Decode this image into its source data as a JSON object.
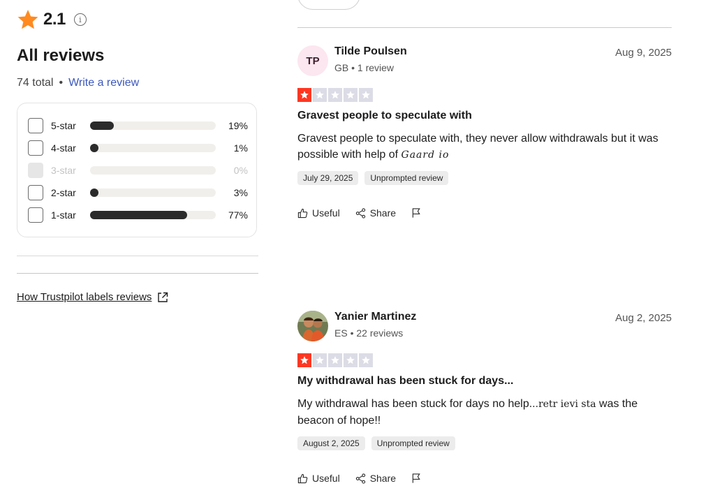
{
  "summary": {
    "rating": "2.1",
    "info_glyph": "i",
    "heading": "All reviews",
    "total": "74 total",
    "separator": "•",
    "write_review": "Write a review",
    "distribution": [
      {
        "label": "5-star",
        "pct": "19%",
        "fraction": 0.19,
        "disabled": false
      },
      {
        "label": "4-star",
        "pct": "1%",
        "fraction": 0.01,
        "disabled": false
      },
      {
        "label": "3-star",
        "pct": "0%",
        "fraction": 0.0,
        "disabled": true
      },
      {
        "label": "2-star",
        "pct": "3%",
        "fraction": 0.03,
        "disabled": false
      },
      {
        "label": "1-star",
        "pct": "77%",
        "fraction": 0.77,
        "disabled": false
      }
    ],
    "labels_link": "How Trustpilot labels reviews"
  },
  "reviews": [
    {
      "avatar_initials": "TP",
      "author": "Tilde Poulsen",
      "meta": "GB • 1 review",
      "date": "Aug 9, 2025",
      "stars": 1,
      "title": "Gravest people to speculate with",
      "body": "Gravest people to speculate with, they never allow withdrawals but it was possible with help of ",
      "body_script": "Gaard io",
      "tag_date": "July 29, 2025",
      "tag_kind": "Unprompted review",
      "useful": "Useful",
      "share": "Share"
    },
    {
      "avatar_initials": "",
      "author": "Yanier Martinez",
      "meta": "ES • 22 reviews",
      "date": "Aug 2, 2025",
      "stars": 1,
      "title": "My withdrawal has been stuck for days...",
      "body": "My withdrawal has been stuck for days no help...",
      "body_script": "retr ievi sta",
      "body_tail": " was the beacon of hope!!",
      "tag_date": "August 2, 2025",
      "tag_kind": "Unprompted review",
      "useful": "Useful",
      "share": "Share"
    }
  ],
  "colors": {
    "accent_link": "#3c57bc",
    "star_on": "#ff3722",
    "star_off": "#dcdce6",
    "rating_star": "#ff8a1f",
    "bar_fill": "#2b2b2b",
    "bar_track": "#f1efeb",
    "avatar_bg": "#fce6ef"
  },
  "icons": {
    "rating_star": "star-icon",
    "info": "info-icon",
    "external": "external-link-icon",
    "useful": "thumbs-up-icon",
    "share": "share-icon",
    "report": "flag-icon"
  }
}
